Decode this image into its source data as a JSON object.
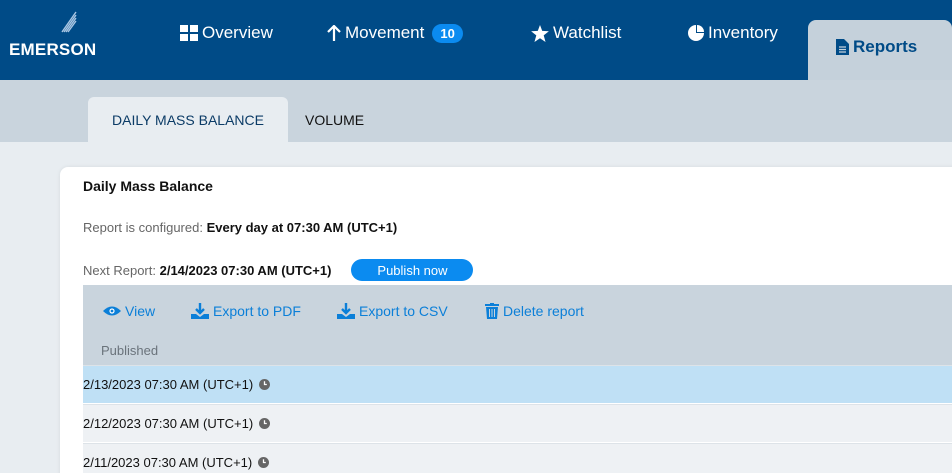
{
  "brand": {
    "name": "EMERSON"
  },
  "nav": {
    "items": [
      {
        "label": "Overview",
        "icon": "grid-icon"
      },
      {
        "label": "Movement",
        "icon": "arrow-up-icon",
        "badge": "10"
      },
      {
        "label": "Watchlist",
        "icon": "star-icon"
      },
      {
        "label": "Inventory",
        "icon": "pie-chart-icon"
      },
      {
        "label": "Reports",
        "icon": "document-icon",
        "active": true
      }
    ]
  },
  "subtabs": [
    {
      "label": "DAILY MASS BALANCE",
      "active": true
    },
    {
      "label": "VOLUME",
      "active": false
    }
  ],
  "report": {
    "title": "Daily Mass Balance",
    "configured_label": "Report is configured:",
    "configured_value": "Every day at 07:30 AM (UTC+1)",
    "next_label": "Next Report:",
    "next_value": "2/14/2023 07:30 AM (UTC+1)",
    "publish_label": "Publish now"
  },
  "toolbar": {
    "view": "View",
    "export_pdf": "Export to PDF",
    "export_csv": "Export to CSV",
    "delete": "Delete report"
  },
  "table": {
    "column": "Published",
    "rows": [
      {
        "published": "2/13/2023 07:30 AM (UTC+1)",
        "selected": true
      },
      {
        "published": "2/12/2023 07:30 AM (UTC+1)",
        "selected": false
      },
      {
        "published": "2/11/2023 07:30 AM (UTC+1)",
        "selected": false
      }
    ]
  },
  "colors": {
    "header_bg": "#004b87",
    "accent": "#0b8bf0",
    "link": "#0b7fd8",
    "selected_row": "#bfe0f5"
  }
}
